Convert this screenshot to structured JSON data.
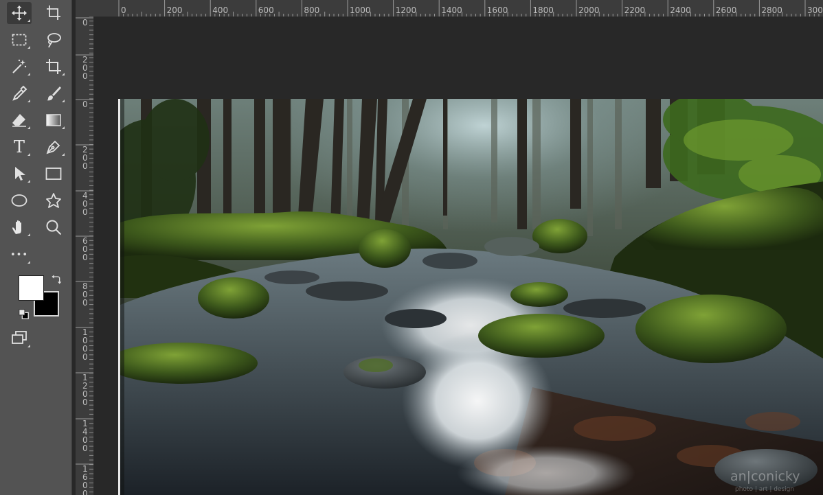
{
  "app": {
    "name": "Photoshop"
  },
  "tools": [
    {
      "id": "move",
      "name": "move-tool",
      "icon": "move-icon"
    },
    {
      "id": "artboard",
      "name": "artboard-tool",
      "icon": "artboard-icon"
    },
    {
      "id": "marquee",
      "name": "rectangular-marquee-tool",
      "icon": "marquee-icon"
    },
    {
      "id": "lasso",
      "name": "lasso-tool",
      "icon": "lasso-icon"
    },
    {
      "id": "wand",
      "name": "magic-wand-tool",
      "icon": "magic-wand-icon"
    },
    {
      "id": "crop",
      "name": "crop-tool",
      "icon": "crop-icon"
    },
    {
      "id": "eyedropper",
      "name": "eyedropper-tool",
      "icon": "eyedropper-icon"
    },
    {
      "id": "brush",
      "name": "brush-tool",
      "icon": "brush-icon"
    },
    {
      "id": "eraser",
      "name": "eraser-tool",
      "icon": "eraser-icon"
    },
    {
      "id": "gradient",
      "name": "gradient-tool",
      "icon": "gradient-icon"
    },
    {
      "id": "type",
      "name": "type-tool",
      "icon": "type-icon",
      "glyph": "T"
    },
    {
      "id": "pen",
      "name": "pen-tool",
      "icon": "pen-icon"
    },
    {
      "id": "select",
      "name": "path-selection-tool",
      "icon": "arrow-icon"
    },
    {
      "id": "rectangle",
      "name": "rectangle-tool",
      "icon": "rectangle-icon"
    },
    {
      "id": "ellipse",
      "name": "ellipse-tool",
      "icon": "ellipse-icon"
    },
    {
      "id": "shape",
      "name": "custom-shape-tool",
      "icon": "custom-shape-icon"
    },
    {
      "id": "hand",
      "name": "hand-tool",
      "icon": "hand-icon"
    },
    {
      "id": "zoom",
      "name": "zoom-tool",
      "icon": "zoom-icon"
    },
    {
      "id": "more",
      "name": "edit-toolbar-button",
      "icon": "more-icon",
      "glyph": "•••"
    }
  ],
  "colors": {
    "foreground": "#ffffff",
    "background": "#000000",
    "ui_panel": "#535353",
    "ui_canvas": "#282828",
    "ruler": "#3c3c3c"
  },
  "rulers": {
    "horizontal": [
      "0",
      "200",
      "400",
      "600",
      "800",
      "1000",
      "1200",
      "1400",
      "1600",
      "1800",
      "2000",
      "2200",
      "2400",
      "2600",
      "2800",
      "300"
    ],
    "vertical": [
      "0",
      "200",
      "0",
      "200",
      "400",
      "600",
      "800",
      "1000",
      "1200",
      "1400",
      "1600"
    ]
  },
  "watermark": {
    "text": "an|conicky",
    "subtext": "photo | art | design"
  }
}
